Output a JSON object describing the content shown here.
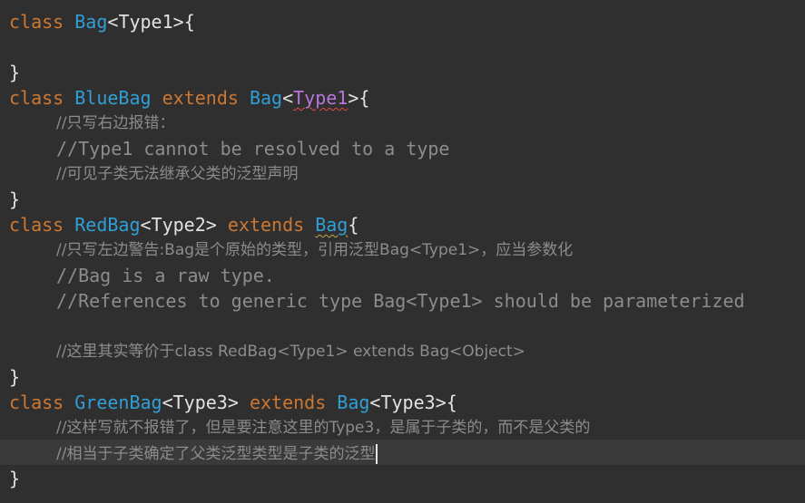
{
  "code": {
    "keywords": {
      "class": "class",
      "extends": "extends"
    },
    "types": {
      "Bag": "Bag",
      "BlueBag": "BlueBag",
      "RedBag": "RedBag",
      "GreenBag": "GreenBag"
    },
    "type_params": {
      "Type1": "Type1",
      "Type2": "Type2",
      "Type3": "Type3"
    },
    "braces": {
      "open": "{",
      "close": "}"
    },
    "comments": {
      "blue_1": "//只写右边报错：",
      "blue_2": "//Type1 cannot be resolved to a type",
      "blue_3": "//可见子类无法继承父类的泛型声明",
      "red_1": "//只写左边警告:Bag是个原始的类型，引用泛型Bag<Type1>，应当参数化",
      "red_2": "//Bag is a raw type.",
      "red_3": "//References to generic type Bag<Type1> should be parameterized",
      "red_4": "//这里其实等价于class RedBag<Type1> extends Bag<Object>",
      "green_1": "//这样写就不报错了，但是要注意这里的Type3，是属于子类的，而不是父类的",
      "green_2": "//相当于子类确定了父类泛型类型是子类的泛型"
    }
  },
  "colors": {
    "background": "#2f2f2f",
    "current_line": "#3a3a3a",
    "keyword": "#cc7832",
    "type": "#2f9fd6",
    "type_param_error": "#b875d9",
    "comment": "#8c8c8c",
    "error_squiggle": "#e04848"
  }
}
